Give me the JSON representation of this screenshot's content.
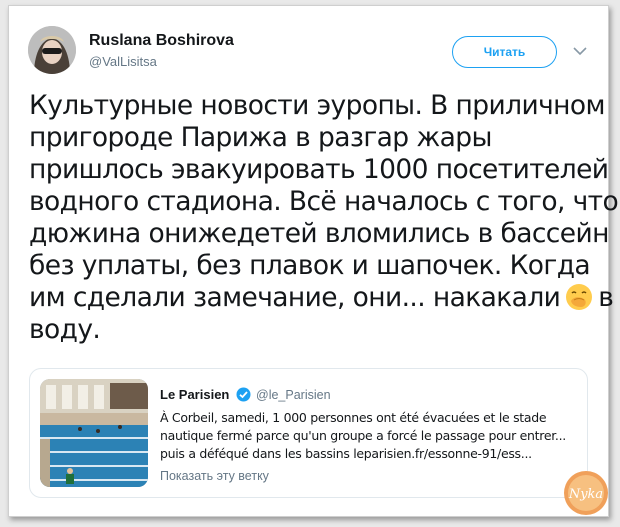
{
  "author": {
    "name": "Ruslana Boshirova",
    "handle": "@ValLisitsa",
    "follow_label": "Читать"
  },
  "tweet": {
    "lines": [
      "Культурные новости эуропы. В приличном",
      "пригороде Парижа в разгар жары",
      "пришлось  эвакуировать 1000 посетителей",
      "водного стадиона. Всё началось с того, что",
      "дюжина онижедетей вломились в бассейн",
      "без уплаты, без плавок и шапочек. Когда"
    ],
    "line7_before": "им сделали замечание, они... накакали",
    "line7_after": "в",
    "line8": "воду.",
    "emoji": "face-with-hand-over-mouth-icon"
  },
  "quoted": {
    "name": "Le Parisien",
    "handle": "@le_Parisien",
    "text_lines": [
      "À Corbeil, samedi, 1 000 personnes ont été évacuées et le stade",
      "nautique fermé parce qu'un groupe a forcé le passage pour entrer...",
      "puis a déféqué dans les bassins leparisien.fr/essonne-91/ess..."
    ],
    "show_thread": "Показать эту ветку"
  },
  "colors": {
    "accent": "#1da1f2",
    "secondary_text": "#657786",
    "text": "#14171a"
  },
  "watermark": {
    "text": "Nyka"
  }
}
